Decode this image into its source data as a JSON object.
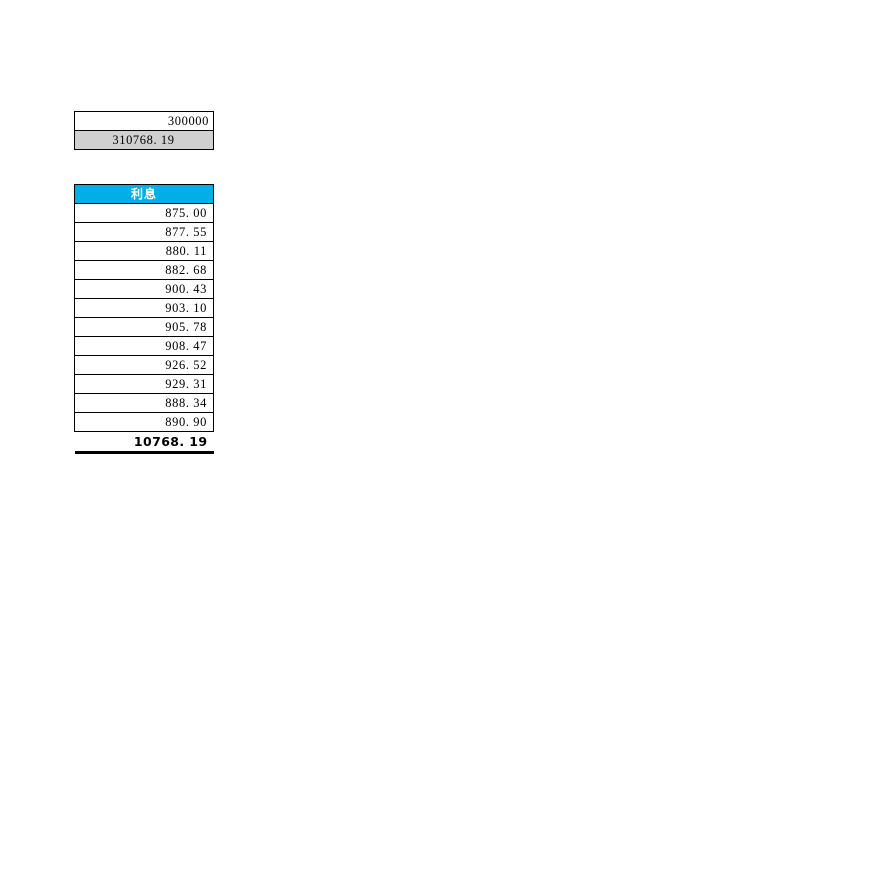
{
  "summary": {
    "rows": [
      {
        "label": "principal",
        "value": "300000",
        "align": "right",
        "shaded": false
      },
      {
        "label": "total_repayment",
        "value": "310768. 19",
        "align": "center",
        "shaded": true
      }
    ]
  },
  "interest": {
    "header": "利息",
    "header_color": "#00aee8",
    "header_text_color": "#ffffff",
    "values": [
      "875. 00",
      "877. 55",
      "880. 11",
      "882. 68",
      "900. 43",
      "903. 10",
      "905. 78",
      "908. 47",
      "926. 52",
      "929. 31",
      "888. 34",
      "890. 90"
    ],
    "total": "10768. 19"
  }
}
